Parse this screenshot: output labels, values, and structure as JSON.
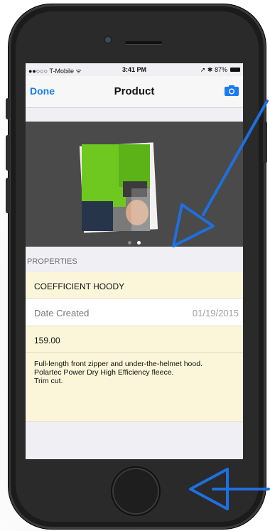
{
  "status_bar": {
    "carrier": "●●○○○ T-Mobile ᯤ",
    "time": "3:41 PM",
    "right": "➚ ✱ 87%"
  },
  "navbar": {
    "done_label": "Done",
    "title": "Product",
    "camera_icon": "camera-icon"
  },
  "gallery": {
    "page_count": 2,
    "current_page": 2
  },
  "properties": {
    "header": "PROPERTIES",
    "name": "COEFFICIENT HOODY",
    "date_label": "Date Created",
    "date_value": "01/19/2015",
    "price": "159.00",
    "description": "Full-length front zipper and under-the-helmet hood.\nPolartec Power Dry High Efficiency fleece.\nTrim cut."
  },
  "colors": {
    "accent": "#1a7cf3",
    "annotation_arrow": "#1f6fe0",
    "row_highlight": "#fbf6d9"
  }
}
